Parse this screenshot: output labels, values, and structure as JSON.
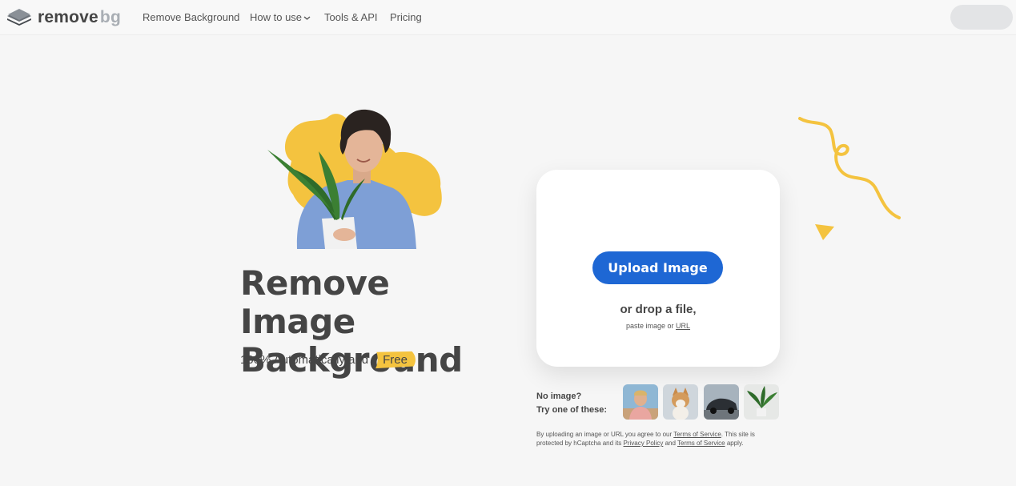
{
  "header": {
    "logo_main": "remove",
    "logo_accent": "bg",
    "nav": [
      {
        "label": "Remove Background"
      },
      {
        "label": "How to use"
      },
      {
        "label": "Tools & API"
      },
      {
        "label": "Pricing"
      }
    ]
  },
  "hero": {
    "title_line1": "Remove Image",
    "title_line2": "Background",
    "subtitle": "100% Automatically and",
    "badge": "Free"
  },
  "upload": {
    "button_label": "Upload Image",
    "drop_text": "or drop a file,",
    "paste_prefix": "paste image or",
    "paste_link": "URL"
  },
  "samples": {
    "line1": "No image?",
    "line2": "Try one of these:",
    "items": [
      "person",
      "dog",
      "car",
      "plant"
    ]
  },
  "legal": {
    "part1": "By uploading an image or URL you agree to our",
    "tos_link": "Terms of Service",
    "part2": ". This site is protected by hCaptcha and its",
    "privacy_link": "Privacy Policy",
    "part3": "and",
    "tos_link2": "Terms of Service",
    "part4": "apply."
  },
  "colors": {
    "accent_blue": "#1e67d4",
    "accent_yellow": "#f4c33f",
    "text": "#454545"
  }
}
